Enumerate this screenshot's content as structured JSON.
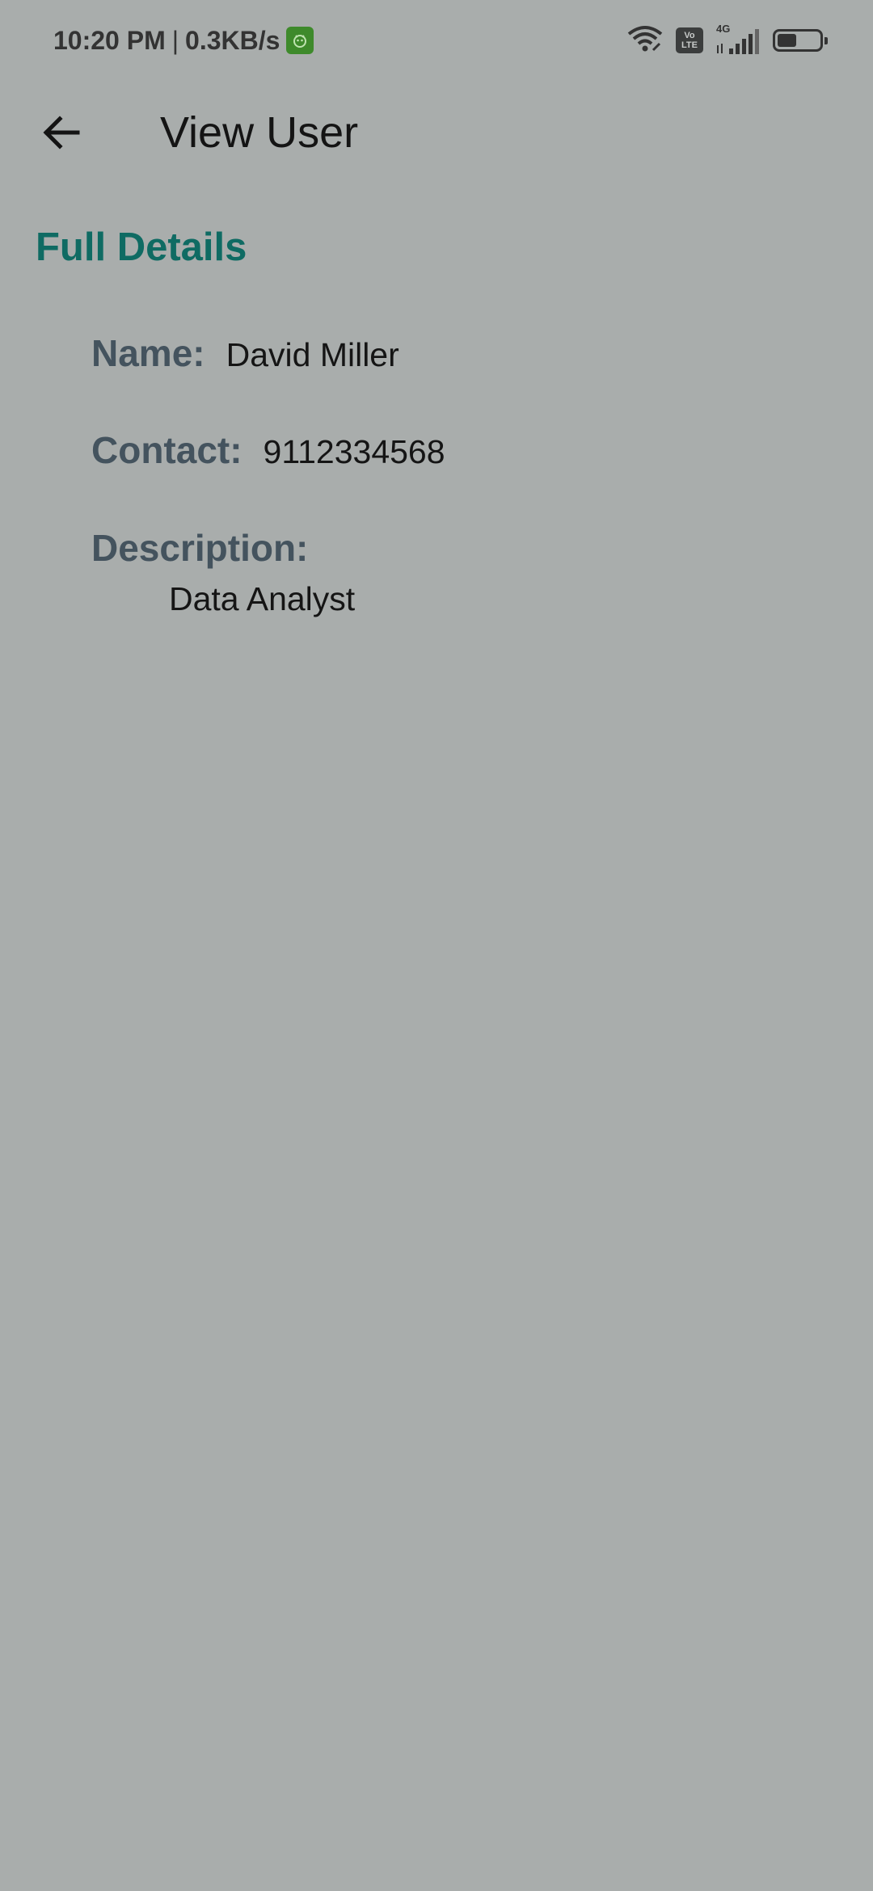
{
  "status_bar": {
    "time": "10:20 PM",
    "separator": "|",
    "network_speed": "0.3KB/s",
    "volte_top": "Vo",
    "volte_bottom": "LTE",
    "network_type": "4G",
    "icons": [
      "wifi-icon",
      "volte-icon",
      "signal-icon",
      "battery-icon"
    ],
    "battery_level": 0.45
  },
  "app_bar": {
    "title": "View User",
    "back_icon": "arrow-left-icon"
  },
  "details": {
    "section_title": "Full Details",
    "name_label": "Name:",
    "name_value": "David Miller",
    "contact_label": "Contact:",
    "contact_value": "9112334568",
    "description_label": "Description:",
    "description_value": "Data Analyst"
  },
  "colors": {
    "background": "#a9adac",
    "accent": "#0f6b63",
    "label": "#44535e",
    "text": "#151515"
  }
}
